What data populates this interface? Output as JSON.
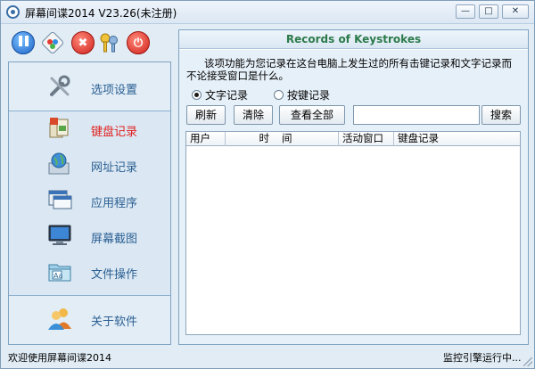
{
  "window": {
    "title": "屏幕间谍2014 V23.26(未注册)",
    "min_glyph": "—",
    "max_glyph": "□",
    "close_glyph": "✕"
  },
  "toolbar": {
    "buttons": [
      {
        "name": "pause",
        "icon": "pause-icon"
      },
      {
        "name": "skin",
        "icon": "skin-icon"
      },
      {
        "name": "stop",
        "icon": "close-circle-icon",
        "glyph": "✖"
      },
      {
        "name": "keys",
        "icon": "keys-icon"
      },
      {
        "name": "power",
        "icon": "power-icon",
        "glyph": "⏻"
      }
    ]
  },
  "nav": {
    "items": [
      {
        "label": "选项设置",
        "icon": "wrench-icon"
      },
      {
        "label": "键盘记录",
        "icon": "keyboard-icon",
        "active": true
      },
      {
        "label": "网址记录",
        "icon": "globe-icon"
      },
      {
        "label": "应用程序",
        "icon": "window-icon"
      },
      {
        "label": "屏幕截图",
        "icon": "monitor-icon"
      },
      {
        "label": "文件操作",
        "icon": "folder-icon"
      },
      {
        "label": "关于软件",
        "icon": "users-icon"
      }
    ]
  },
  "panel": {
    "title": "Records of Keystrokes",
    "description": "该项功能为您记录在这台电脑上发生过的所有击键记录和文字记录而不论接受窗口是什么。",
    "radios": [
      {
        "label": "文字记录",
        "checked": true
      },
      {
        "label": "按键记录",
        "checked": false
      }
    ],
    "buttons": {
      "refresh": "刷新",
      "clear": "清除",
      "view_all": "查看全部",
      "search": "搜索"
    },
    "search_value": "",
    "table": {
      "columns": [
        "用户",
        "时间",
        "活动窗口",
        "键盘记录"
      ],
      "rows": []
    }
  },
  "status": {
    "left": "欢迎使用屏幕间谍2014",
    "right": "监控引擎运行中..."
  },
  "colors": {
    "accent_title": "#2c7a4a",
    "active_nav": "#e02020",
    "nav_text": "#2b5f92"
  }
}
